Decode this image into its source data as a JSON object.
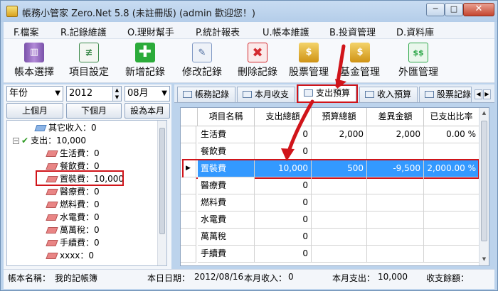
{
  "window": {
    "title": "帳務小管家 Zero.Net 5.8 (未註冊版) (admin 歡迎您！)",
    "min_label": "─",
    "max_label": "□",
    "close_label": "✕"
  },
  "menu": [
    "F.檔案",
    "R.記錄維護",
    "O.理財幫手",
    "P.統計報表",
    "U.帳本維護",
    "B.投資管理",
    "D.資料庫"
  ],
  "toolbar": [
    {
      "label": "帳本選擇",
      "icon": "books-icon",
      "color": "#8a63b8"
    },
    {
      "label": "項目設定",
      "icon": "ledger-icon",
      "color": "#3d8a4b"
    },
    {
      "label": "新增記錄",
      "icon": "add-icon",
      "color": "#2bab3a"
    },
    {
      "label": "修改記錄",
      "icon": "eraser-icon",
      "color": "#7f98c4"
    },
    {
      "label": "刪除記錄",
      "icon": "delete-icon",
      "color": "#d4292e"
    },
    {
      "label": "股票管理",
      "icon": "stock-icon",
      "color": "#d9a21e"
    },
    {
      "label": "基金管理",
      "icon": "fund-icon",
      "color": "#d9a21e"
    },
    {
      "label": "外匯管理",
      "icon": "forex-icon",
      "color": "#2fa84a"
    }
  ],
  "filter": {
    "period_type": "年份",
    "year": "2012",
    "month": "08月",
    "prev_month": "上個月",
    "next_month": "下個月",
    "set_current": "設為本月"
  },
  "tree": [
    {
      "text": "其它收入：0",
      "icon": "blue",
      "indent": 2
    },
    {
      "text": "支出：10,000",
      "icon": "check",
      "indent": 0
    },
    {
      "text": "生活費：0",
      "icon": "pink",
      "indent": 2
    },
    {
      "text": "餐飲費：0",
      "icon": "pink",
      "indent": 2
    },
    {
      "text": "置裝費：10,000",
      "icon": "pink",
      "indent": 2
    },
    {
      "text": "醫療費：0",
      "icon": "pink",
      "indent": 2
    },
    {
      "text": "燃料費：0",
      "icon": "pink",
      "indent": 2
    },
    {
      "text": "水電費：0",
      "icon": "pink",
      "indent": 2
    },
    {
      "text": "萬萬稅：0",
      "icon": "pink",
      "indent": 2
    },
    {
      "text": "手續費：0",
      "icon": "pink",
      "indent": 2
    },
    {
      "text": "xxxx：0",
      "icon": "pink",
      "indent": 2
    }
  ],
  "tabs": [
    "帳務記錄",
    "本月收支",
    "支出預算",
    "收入預算",
    "股票記錄"
  ],
  "active_tab": 2,
  "grid": {
    "headers": [
      "項目名稱",
      "支出總額",
      "預算總額",
      "差異金額",
      "已支出比率"
    ],
    "rows": [
      [
        "生活費",
        "0",
        "2,000",
        "2,000",
        "0.00 %"
      ],
      [
        "餐飲費",
        "0",
        "",
        "",
        ""
      ],
      [
        "置裝費",
        "10,000",
        "500",
        "-9,500",
        "2,000.00 %"
      ],
      [
        "醫療費",
        "0",
        "",
        "",
        ""
      ],
      [
        "燃料費",
        "0",
        "",
        "",
        ""
      ],
      [
        "水電費",
        "0",
        "",
        "",
        ""
      ],
      [
        "萬萬稅",
        "0",
        "",
        "",
        ""
      ],
      [
        "手續費",
        "0",
        "",
        "",
        ""
      ]
    ],
    "selected_row": 2
  },
  "status": {
    "book_label": "帳本名稱：",
    "book_name": "我的記帳簿",
    "date_label": "本日日期：",
    "date_value": "2012/08/16",
    "income_label": "本月收入：",
    "income_value": "0",
    "expense_label": "本月支出：",
    "expense_value": "10,000",
    "balance_label": "收支餘額："
  },
  "colors": {
    "selection": "#3399ff",
    "highlight": "#d0141a",
    "window_bg": "#bcd3ec"
  }
}
